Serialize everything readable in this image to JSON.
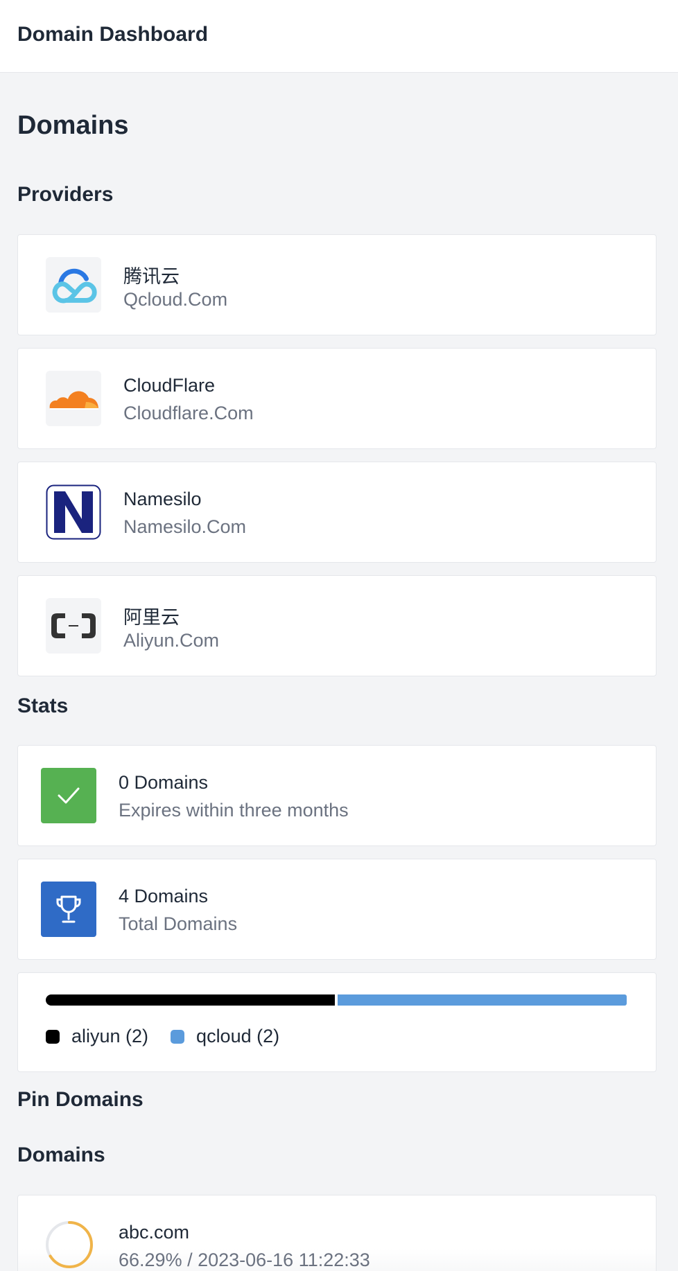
{
  "header": {
    "title": "Domain Dashboard"
  },
  "page": {
    "title": "Domains"
  },
  "providers": {
    "heading": "Providers",
    "items": [
      {
        "name": "腾讯云",
        "domain": "Qcloud.Com",
        "icon": "qcloud-logo"
      },
      {
        "name": "CloudFlare",
        "domain": "Cloudflare.Com",
        "icon": "cloudflare-logo"
      },
      {
        "name": "Namesilo",
        "domain": "Namesilo.Com",
        "icon": "namesilo-logo"
      },
      {
        "name": "阿里云",
        "domain": "Aliyun.Com",
        "icon": "aliyun-logo"
      }
    ]
  },
  "stats": {
    "heading": "Stats",
    "expiring": {
      "value": "0 Domains",
      "label": "Expires within three months",
      "icon": "check-icon",
      "color": "#56b152"
    },
    "total": {
      "value": "4 Domains",
      "label": "Total Domains",
      "icon": "trophy-icon",
      "color": "#2f6bc6"
    },
    "distribution": [
      {
        "label": "aliyun (2)",
        "share": 0.5,
        "color": "#000000"
      },
      {
        "label": "qcloud (2)",
        "share": 0.5,
        "color": "#5b9bdc"
      }
    ]
  },
  "pin": {
    "heading": "Pin Domains"
  },
  "domains": {
    "heading": "Domains",
    "items": [
      {
        "name": "abc.com",
        "info": "66.29% / 2023-06-16 11:22:33",
        "progress": 0.6629,
        "color": "#f0b449"
      }
    ]
  }
}
